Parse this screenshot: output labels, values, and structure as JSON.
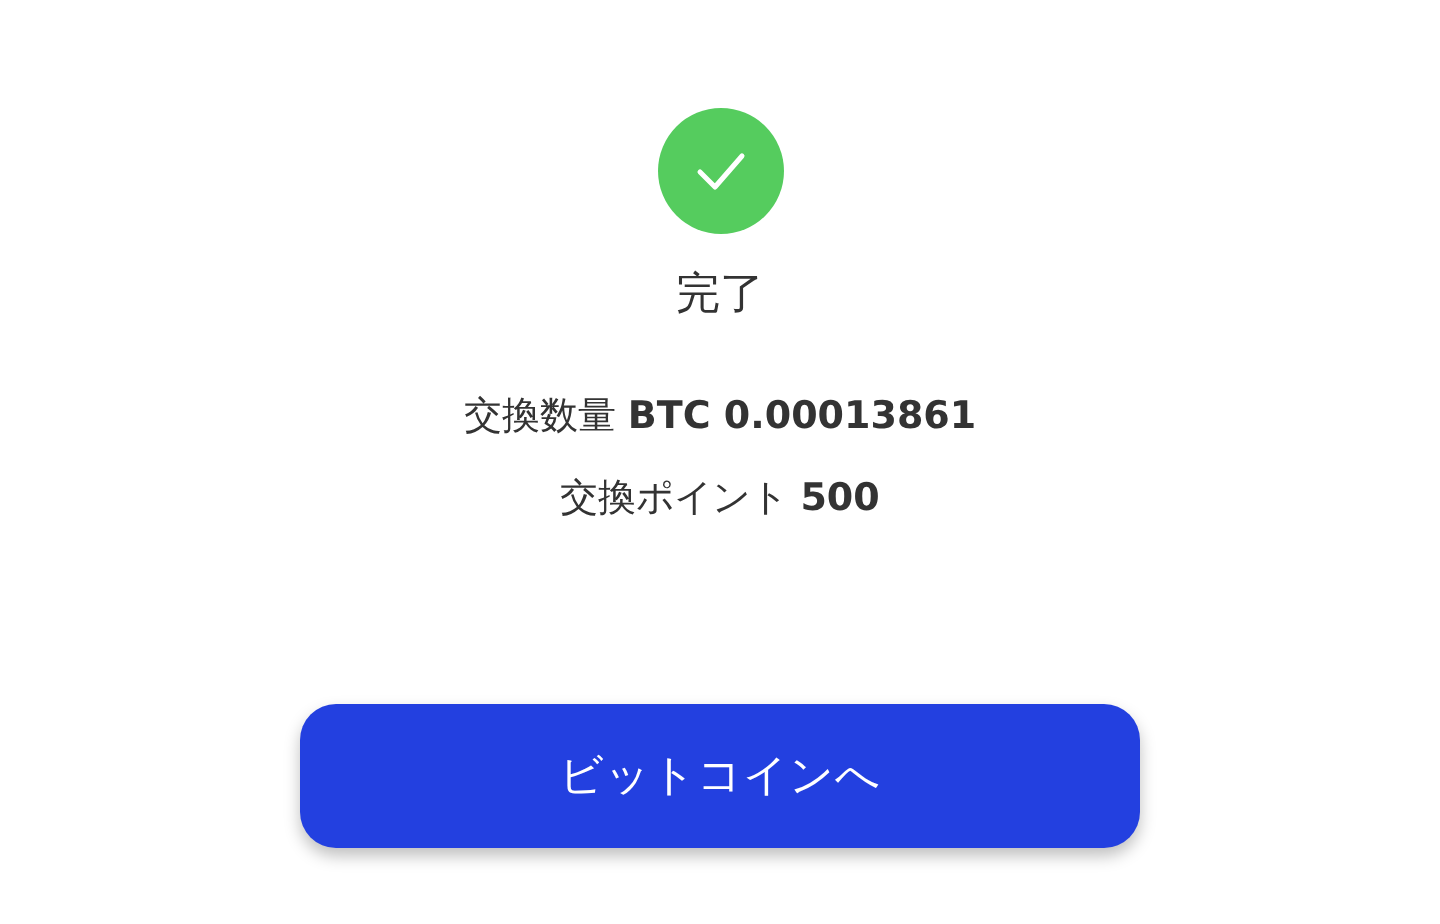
{
  "status": {
    "title": "完了"
  },
  "details": [
    "交換数量 **BTC 0.00013861**",
    "交換ポイント **500**"
  ],
  "button": {
    "label": "ビットコインへ"
  }
}
